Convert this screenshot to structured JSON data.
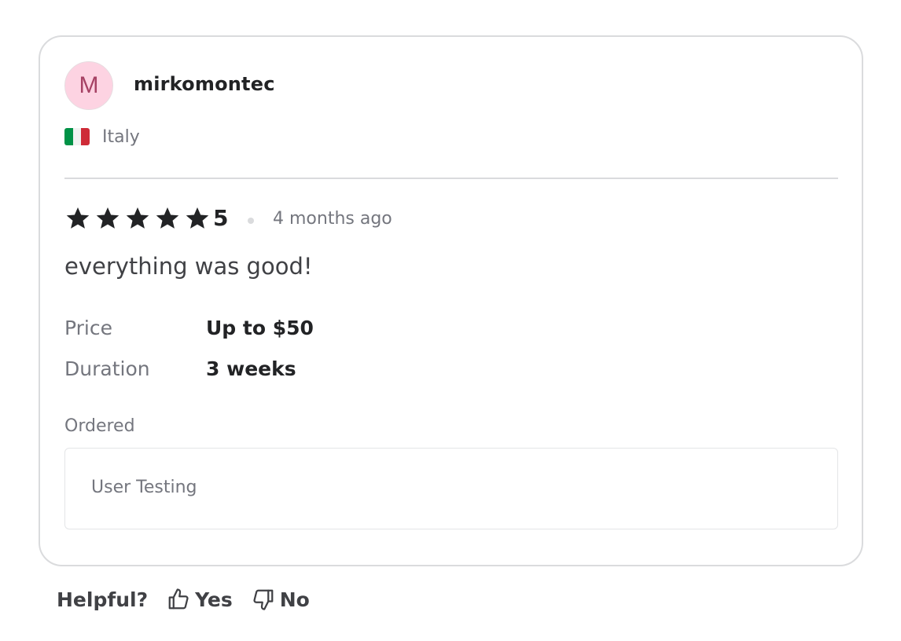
{
  "review": {
    "avatar_initial": "M",
    "username": "mirkomontec",
    "country": "Italy",
    "flag_colors": [
      "#009246",
      "#f1f2f1",
      "#ce2b37"
    ],
    "rating": 5,
    "rating_label": "5",
    "time_ago": "4 months ago",
    "text": "everything was good!",
    "details": [
      {
        "label": "Price",
        "value": "Up to $50"
      },
      {
        "label": "Duration",
        "value": "3 weeks"
      }
    ],
    "ordered_label": "Ordered",
    "ordered_item": "User Testing"
  },
  "helpful": {
    "label": "Helpful?",
    "yes_label": "Yes",
    "no_label": "No"
  },
  "colors": {
    "avatar_bg": "#fdd3e2",
    "avatar_text": "#a64264",
    "star": "#222325",
    "muted_text": "#74767e",
    "border": "#dadbdd"
  }
}
